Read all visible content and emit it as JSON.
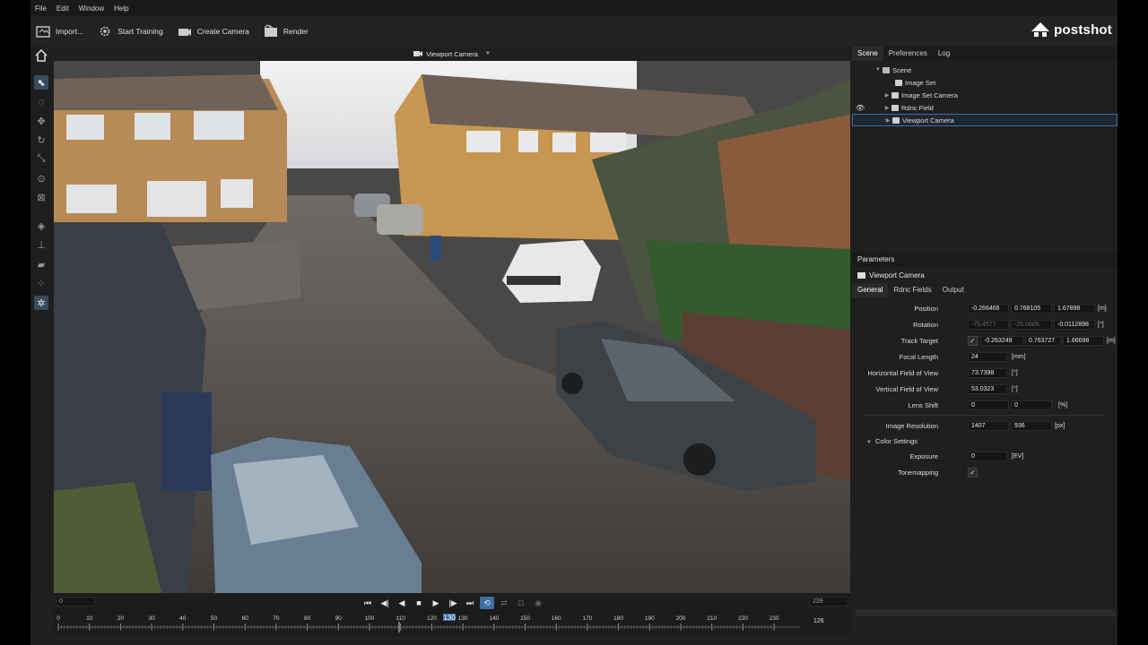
{
  "menu": {
    "items": [
      "File",
      "Edit",
      "Window",
      "Help"
    ]
  },
  "toolbar": {
    "import_label": "Import...",
    "start_training_label": "Start Training",
    "create_camera_label": "Create Camera",
    "render_label": "Render"
  },
  "brand": {
    "name": "postshot"
  },
  "viewport": {
    "camera_label": "Viewport Camera"
  },
  "timeline": {
    "start_field": "0",
    "end_field": "239",
    "current_frame": "126",
    "marker_label": "130",
    "ticks": [
      "0",
      "10",
      "20",
      "30",
      "40",
      "50",
      "60",
      "70",
      "80",
      "90",
      "100",
      "110",
      "120",
      "130",
      "140",
      "150",
      "160",
      "170",
      "180",
      "190",
      "200",
      "210",
      "220",
      "230"
    ]
  },
  "scene_panel": {
    "tabs": [
      "Scene",
      "Preferences",
      "Log"
    ],
    "tree": [
      "Scene",
      "Image Set",
      "Image Set Camera",
      "Rdnc Field",
      "Viewport Camera"
    ]
  },
  "parameters": {
    "header": "Parameters",
    "title": "Viewport Camera",
    "tabs": [
      "General",
      "Rdnc Fields",
      "Output"
    ],
    "position": {
      "label": "Position",
      "x": "-0.266466",
      "y": "0.768105",
      "z": "1.67898",
      "unit": "[m]"
    },
    "rotation": {
      "label": "Rotation",
      "x": "-79.4577",
      "y": "-35.0605",
      "z": "-0.0112898",
      "unit": "[°]"
    },
    "track_target": {
      "label": "Track Target",
      "x": "-0.263249",
      "y": "0.763727",
      "z": "1.66698",
      "unit": "[m]"
    },
    "focal_length": {
      "label": "Focal Length",
      "value": "24",
      "unit": "[mm]"
    },
    "hfov": {
      "label": "Horizontal Field of View",
      "value": "73.7398",
      "unit": "[°]"
    },
    "vfov": {
      "label": "Vertical Field of View",
      "value": "53.0323",
      "unit": "[°]"
    },
    "lens_shift": {
      "label": "Lens Shift",
      "x": "0",
      "y": "0",
      "unit": "[%]"
    },
    "image_resolution": {
      "label": "Image Resolution",
      "w": "1407",
      "h": "936",
      "unit": "[px]"
    },
    "color_settings": "Color Settings",
    "exposure": {
      "label": "Exposure",
      "value": "0",
      "unit": "[EV]"
    },
    "tonemapping": {
      "label": "Tonemapping"
    }
  }
}
